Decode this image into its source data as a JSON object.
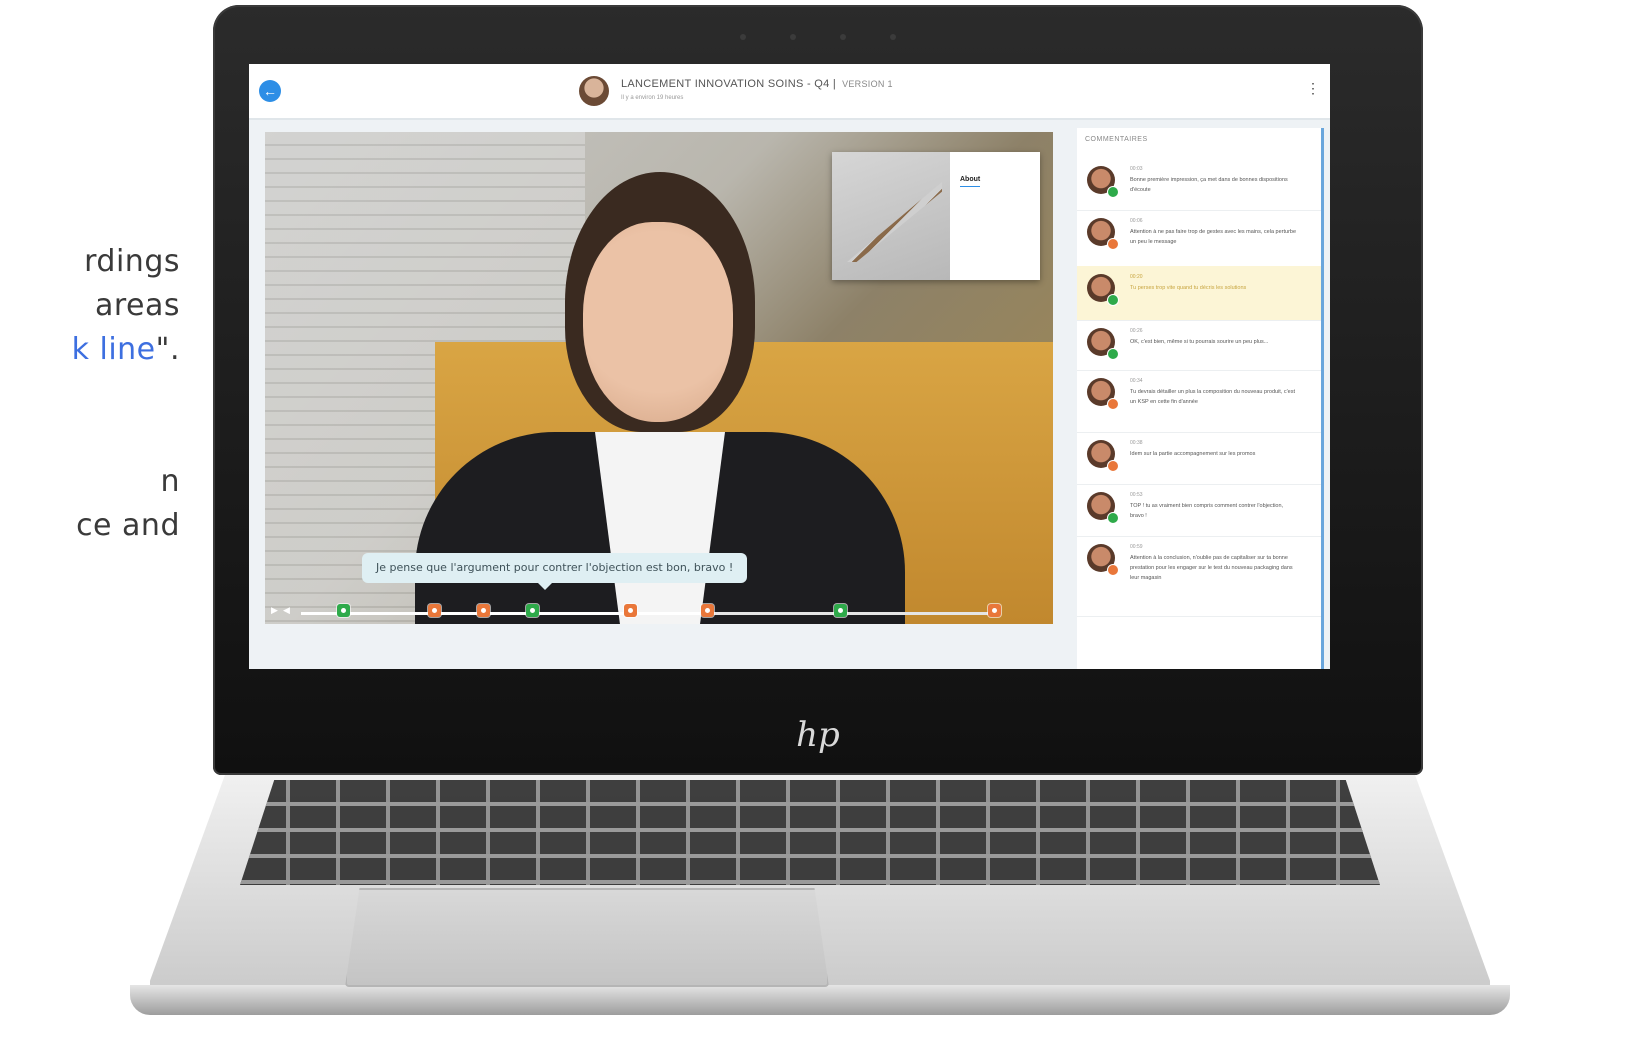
{
  "side_text": {
    "line1": "rdings",
    "line2": "areas",
    "line3_accent": "k line",
    "line3_suffix": "\".",
    "line4": "n",
    "line5": "ce and"
  },
  "laptop": {
    "logo": "hp"
  },
  "app": {
    "title": "LANCEMENT INNOVATION SOINS - Q4 |",
    "version": "VERSION 1",
    "subtitle": "Il y a environ 19 heures",
    "back_icon": "arrow-left-icon",
    "more_icon": "more-vertical-icon"
  },
  "video": {
    "slide_title": "About",
    "caption": "Je pense que l'argument pour contrer l'objection est bon, bravo !",
    "progress": 0.58,
    "markers": [
      {
        "pos": 0.06,
        "type": "positive"
      },
      {
        "pos": 0.19,
        "type": "negative"
      },
      {
        "pos": 0.26,
        "type": "negative"
      },
      {
        "pos": 0.33,
        "type": "positive"
      },
      {
        "pos": 0.47,
        "type": "negative"
      },
      {
        "pos": 0.58,
        "type": "negative"
      },
      {
        "pos": 0.77,
        "type": "positive"
      },
      {
        "pos": 0.99,
        "type": "negative"
      }
    ]
  },
  "comments": {
    "title": "COMMENTAIRES",
    "items": [
      {
        "time": "00:03",
        "text": "Bonne première impression, ça met dans de bonnes dispositions d'écoute",
        "status": "positive",
        "highlight": false
      },
      {
        "time": "00:06",
        "text": "Attention à ne pas faire trop de gestes avec les mains, cela perturbe un peu le message",
        "status": "negative",
        "highlight": false
      },
      {
        "time": "00:20",
        "text": "Tu perses trop vite quand tu décris les solutions",
        "status": "positive",
        "highlight": true
      },
      {
        "time": "00:26",
        "text": "OK, c'est bien, même si tu pourrais sourire un peu plus...",
        "status": "positive",
        "highlight": false
      },
      {
        "time": "00:34",
        "text": "Tu devrais détailler un plus la composition du nouveau produit, c'est un KSP en cette fin d'année",
        "status": "negative",
        "highlight": false
      },
      {
        "time": "00:38",
        "text": "Idem sur la partie accompagnement sur les promos",
        "status": "negative",
        "highlight": false
      },
      {
        "time": "00:53",
        "text": "TOP ! tu as vraiment bien compris comment contrer l'objection, bravo !",
        "status": "positive",
        "highlight": false
      },
      {
        "time": "00:59",
        "text": "Attention à la conclusion, n'oublie pas de capitaliser sur ta bonne prestation pour les engager sur le test du nouveau packaging dans leur magasin",
        "status": "negative",
        "highlight": false
      }
    ]
  }
}
